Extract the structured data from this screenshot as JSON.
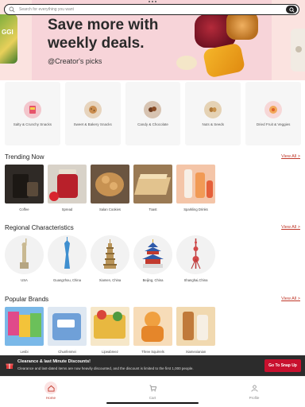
{
  "search": {
    "placeholder": "Search for everything you want"
  },
  "banner": {
    "headline": "Save more with weekly deals.",
    "subtitle": "@Creator's picks",
    "side_tag": "GGI"
  },
  "categories": [
    {
      "label": "Salty & Crunchy Snacks",
      "icon": "chips-icon",
      "color": "#f3c6cc"
    },
    {
      "label": "Sweet & Bakery Snacks",
      "icon": "cookie-icon",
      "color": "#e7d4bd"
    },
    {
      "label": "Candy & Chocolate",
      "icon": "chocolate-icon",
      "color": "#d7c3b1"
    },
    {
      "label": "Nuts & Seeds",
      "icon": "nuts-icon",
      "color": "#e5d2b4"
    },
    {
      "label": "Dried Fruit & Veggies",
      "icon": "dried-fruit-icon",
      "color": "#f7d7d7"
    }
  ],
  "trending": {
    "title": "Trending Now",
    "view_all": "View All >",
    "items": [
      {
        "label": "Coffee",
        "color": "#2f2a26"
      },
      {
        "label": "Spread",
        "color": "#b8202a"
      },
      {
        "label": "Salan Cookies",
        "color": "#c79252"
      },
      {
        "label": "Toast",
        "color": "#e2c38e"
      },
      {
        "label": "Sparkling Drinks",
        "color": "#e9a77f"
      }
    ]
  },
  "regional": {
    "title": "Regional Characteristics",
    "view_all": "View All >",
    "items": [
      {
        "label": "USA",
        "icon": "statue-of-liberty-icon"
      },
      {
        "label": "Guangzhou, China",
        "icon": "canton-tower-icon"
      },
      {
        "label": "Xiamen, China",
        "icon": "pagoda-icon"
      },
      {
        "label": "Beijing, China",
        "icon": "temple-of-heaven-icon"
      },
      {
        "label": "Shanghai,China",
        "icon": "pearl-tower-icon"
      }
    ]
  },
  "brands": {
    "title": "Popular Brands",
    "view_all": "View All >",
    "items": [
      {
        "label": "Lesbi",
        "color": "#e04a8a"
      },
      {
        "label": "Chunfenmei",
        "color": "#6fa0d8"
      },
      {
        "label": "Lipeabreez",
        "color": "#e8b840"
      },
      {
        "label": "Three Squirrels",
        "color": "#f0a040"
      },
      {
        "label": "Xiameoianian",
        "color": "#c07a3a"
      }
    ]
  },
  "promo": {
    "title": "Clearance & last Minute Discounts!",
    "text": "Clearance and last-dated items are now heavily discounted, and the discount is limited to the first 1,000 people.",
    "button": "Go To Snap Up",
    "accent": "#c8102e"
  },
  "nav": [
    {
      "label": "Home",
      "icon": "home-icon",
      "active": true
    },
    {
      "label": "Cart",
      "icon": "cart-icon",
      "active": false
    },
    {
      "label": "Profile",
      "icon": "profile-icon",
      "active": false
    }
  ]
}
